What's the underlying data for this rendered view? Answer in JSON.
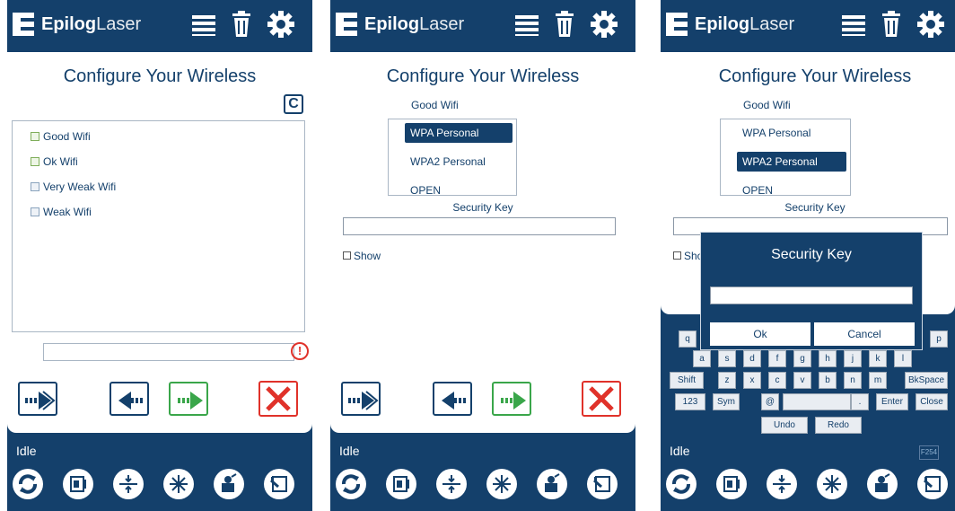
{
  "brand": {
    "bold": "Epilog",
    "light": "Laser"
  },
  "header_icons": [
    "list-icon",
    "trash-icon",
    "gear-icon"
  ],
  "colors": {
    "brand_blue": "#14406b",
    "green": "#3aa64a",
    "red": "#e0322a",
    "white": "#ffffff"
  },
  "screen1": {
    "title": "Configure Your Wireless",
    "networks": [
      {
        "label": "Good Wifi"
      },
      {
        "label": "Ok Wifi"
      },
      {
        "label": "Very Weak Wifi"
      },
      {
        "label": "Weak Wifi"
      }
    ],
    "status": "Idle"
  },
  "screen2": {
    "title": "Configure Your Wireless",
    "network": "Good Wifi",
    "encryption_options": [
      "WPA Personal",
      "WPA2 Personal",
      "OPEN"
    ],
    "selected_encryption": "WPA Personal",
    "security_key_label": "Security Key",
    "security_key_value": "",
    "show_label": "Show",
    "status": "Idle"
  },
  "screen3": {
    "title": "Configure Your Wireless",
    "network": "Good Wifi",
    "encryption_options": [
      "WPA Personal",
      "WPA2 Personal",
      "OPEN"
    ],
    "selected_encryption": "WPA2 Personal",
    "security_key_label": "Security Key",
    "show_label": "Sho",
    "dialog": {
      "title": "Security Key",
      "ok": "Ok",
      "cancel": "Cancel"
    },
    "keyboard": {
      "row1": [
        "q",
        "p"
      ],
      "row2": [
        "a",
        "s",
        "d",
        "f",
        "g",
        "h",
        "j",
        "k",
        "l"
      ],
      "row3": [
        "Shift",
        "z",
        "x",
        "c",
        "v",
        "b",
        "n",
        "m",
        "BkSpace"
      ],
      "row4": [
        "123",
        "Sym",
        "@",
        ".",
        "Enter",
        "Close"
      ],
      "row5": [
        "Undo",
        "Redo"
      ]
    },
    "status": "Idle",
    "fcode": "F254"
  },
  "toolbar_icons": [
    "refresh-icon",
    "frame-icon",
    "focus-icon",
    "laser-icon",
    "jog-icon",
    "home-icon"
  ]
}
